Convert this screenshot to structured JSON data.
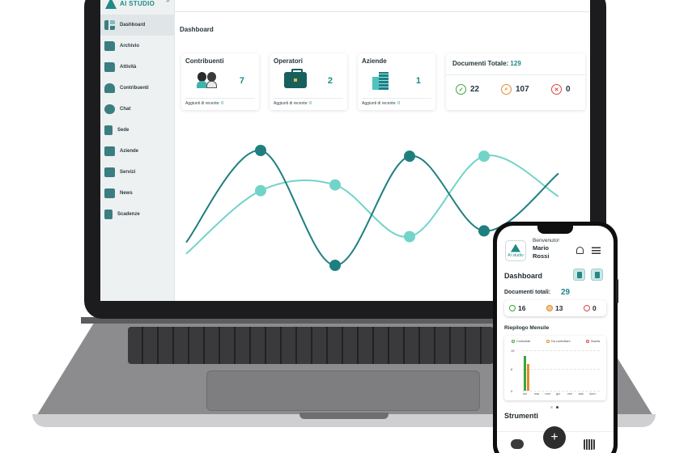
{
  "laptop": {
    "logo_text": "AI STUDIO",
    "sidebar": {
      "items": [
        {
          "label": "Dashboard",
          "icon": "dashboard-icon",
          "active": true
        },
        {
          "label": "Archivio",
          "icon": "archive-icon"
        },
        {
          "label": "Attività",
          "icon": "folder-icon"
        },
        {
          "label": "Contribuenti",
          "icon": "people-icon"
        },
        {
          "label": "Chat",
          "icon": "chat-icon"
        },
        {
          "label": "Sede",
          "icon": "document-icon"
        },
        {
          "label": "Aziende",
          "icon": "building-icon"
        },
        {
          "label": "Servizi",
          "icon": "services-icon"
        },
        {
          "label": "News",
          "icon": "news-icon"
        },
        {
          "label": "Scadenze",
          "icon": "calendar-icon"
        }
      ]
    },
    "page_title": "Dashboard",
    "cards": {
      "contribuenti": {
        "title": "Contribuenti",
        "count": "7",
        "foot_label": "Aggiunti di recente:",
        "foot_value": "0"
      },
      "operatori": {
        "title": "Operatori",
        "count": "2",
        "foot_label": "Aggiunti di recente:",
        "foot_value": "0"
      },
      "aziende": {
        "title": "Aziende",
        "count": "1",
        "foot_label": "Aggiunti di recente:",
        "foot_value": "0"
      }
    },
    "documenti": {
      "title": "Documenti Totale:",
      "total": "129",
      "controllati": "22",
      "da_controllare": "107",
      "scartati": "0"
    }
  },
  "phone": {
    "logo_text": "AI studio",
    "welcome": "Benvenuto!",
    "user_name": "Mario Rossi",
    "page_title": "Dashboard",
    "docs_label": "Documenti totali:",
    "docs_total": "29",
    "controllati": "16",
    "da_controllare": "13",
    "scartati": "0",
    "riepilogo_title": "Riepilogo Mensile",
    "legend": {
      "controllati": "Controllati",
      "da_controllare": "Da controllare",
      "scartati": "Scarta"
    },
    "strumenti_title": "Strumenti",
    "fab_label": "+"
  },
  "colors": {
    "accent": "#1f8a87",
    "accent_light": "#6fd0c8",
    "ok": "#3aa63a",
    "warn": "#e38a2a",
    "danger": "#d94545"
  },
  "chart_data": [
    {
      "type": "line",
      "title": "",
      "x": [
        1,
        2,
        3,
        4,
        5,
        6
      ],
      "series": [
        {
          "values": [
            0.2,
            1.0,
            0.0,
            0.95,
            0.3,
            0.8
          ]
        },
        {
          "values": [
            0.1,
            0.65,
            0.7,
            0.25,
            0.95,
            0.6
          ]
        }
      ],
      "grid": false
    },
    {
      "type": "bar",
      "title": "Riepilogo Mensile",
      "categories": [
        "lun",
        "mar",
        "mer",
        "gio",
        "ven",
        "sab",
        "dom"
      ],
      "yticks": [
        "15",
        "8",
        "0"
      ],
      "ylim": [
        0,
        15
      ],
      "series": [
        {
          "name": "Controllati",
          "values": [
            13,
            0,
            0,
            0,
            0,
            0,
            0
          ]
        },
        {
          "name": "Da controllare",
          "values": [
            10,
            0,
            0,
            0,
            0,
            0,
            0
          ]
        },
        {
          "name": "Scarta",
          "values": [
            0,
            0,
            0,
            0,
            0,
            0,
            0
          ]
        }
      ]
    }
  ]
}
